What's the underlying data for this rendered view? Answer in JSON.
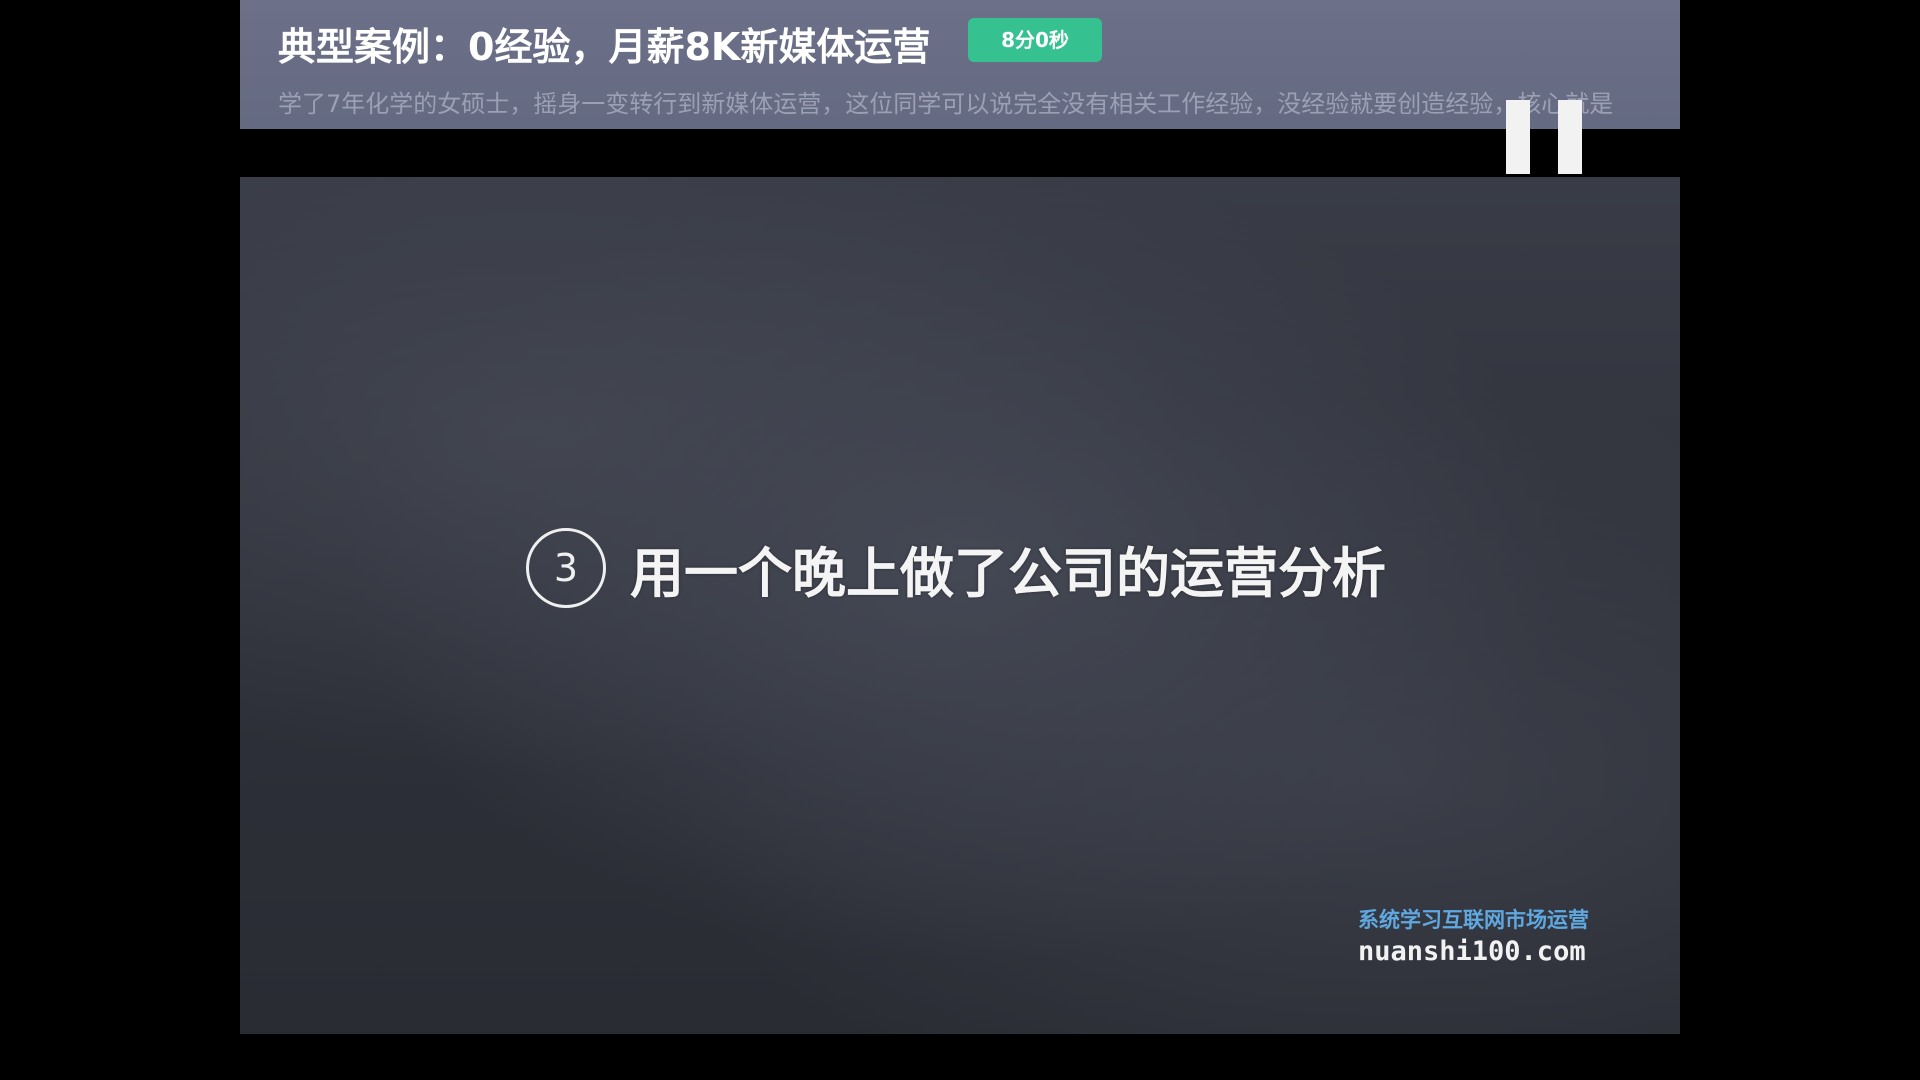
{
  "header": {
    "title": "典型案例：0经验，月薪8K新媒体运营",
    "duration": "8分0秒",
    "description": "学了7年化学的女硕士，摇身一变转行到新媒体运营，这位同学可以说完全没有相关工作经验，没经验就要创造经验，核心就是"
  },
  "controls": {
    "pause_icon": "pause-icon"
  },
  "video": {
    "step_number": "3",
    "subtitle": "用一个晚上做了公司的运营分析",
    "watermark": {
      "tagline": "系统学习互联网市场运营",
      "url": "nuanshi100.com"
    }
  },
  "colors": {
    "header_bg": "#666b84",
    "badge_green": "#35c190",
    "watermark_blue": "#5fa8e0"
  }
}
